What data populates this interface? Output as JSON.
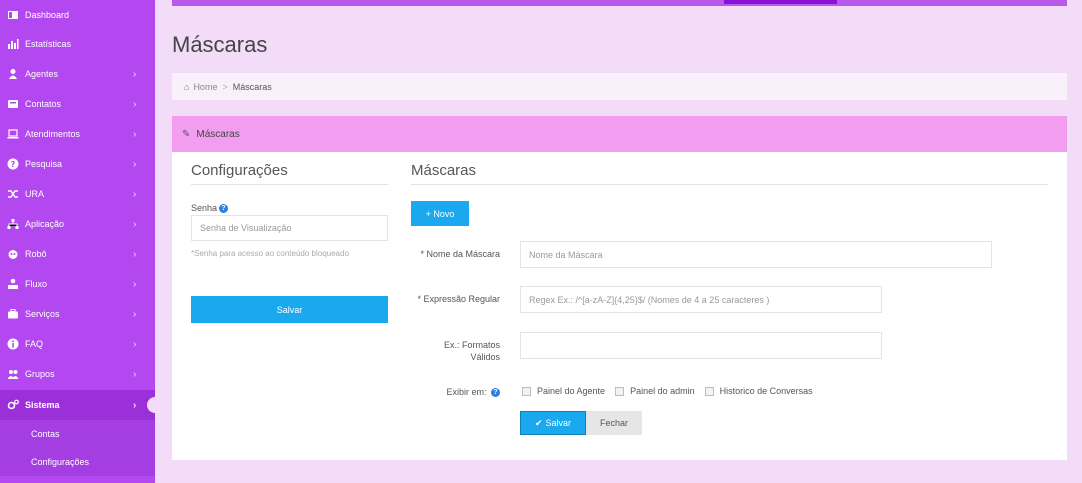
{
  "colors": {
    "sidebar": "#b348f0",
    "sidebar_active": "#9b2fd8",
    "page_bg": "#f3dcf8",
    "panel_header": "#f29ef0",
    "primary_button": "#1aa8ef",
    "topbar_accent": "#8a12d8"
  },
  "sidebar": {
    "items": [
      {
        "label": "Dashboard",
        "icon": "dashboard-icon",
        "has_children": false
      },
      {
        "label": "Estatísticas",
        "icon": "bar-chart-icon",
        "has_children": false
      },
      {
        "label": "Agentes",
        "icon": "person-icon",
        "has_children": true
      },
      {
        "label": "Contatos",
        "icon": "contact-card-icon",
        "has_children": true
      },
      {
        "label": "Atendimentos",
        "icon": "laptop-icon",
        "has_children": true
      },
      {
        "label": "Pesquisa",
        "icon": "question-circle-icon",
        "has_children": true
      },
      {
        "label": "URA",
        "icon": "shuffle-icon",
        "has_children": true
      },
      {
        "label": "Aplicação",
        "icon": "sitemap-icon",
        "has_children": true
      },
      {
        "label": "Robô",
        "icon": "robot-icon",
        "has_children": true
      },
      {
        "label": "Fluxo",
        "icon": "flow-icon",
        "has_children": true
      },
      {
        "label": "Serviços",
        "icon": "briefcase-icon",
        "has_children": true
      },
      {
        "label": "FAQ",
        "icon": "info-circle-icon",
        "has_children": true
      },
      {
        "label": "Grupos",
        "icon": "users-icon",
        "has_children": true
      },
      {
        "label": "Sistema",
        "icon": "cogs-icon",
        "has_children": true,
        "active": true
      }
    ],
    "subitems": [
      {
        "label": "Contas"
      },
      {
        "label": "Configurações"
      }
    ]
  },
  "page": {
    "title": "Máscaras"
  },
  "breadcrumb": {
    "home": "Home",
    "separator": ">",
    "current": "Máscaras"
  },
  "panel": {
    "title": "Máscaras"
  },
  "config": {
    "title": "Configurações",
    "password_label": "Senha",
    "password_placeholder": "Senha de Visualização",
    "hint": "*Senha para acesso ao conteúdo bloqueado",
    "save_label": "Salvar"
  },
  "masks": {
    "title": "Máscaras",
    "new_button": "+ Novo",
    "name_label": "Nome da Máscara",
    "name_placeholder": "Nome da Máscara",
    "regex_label": "Expressão Regular",
    "regex_placeholder": "Regex Ex.: /^[a-zA-Z]{4,25}$/ (Nomes de 4 a 25 caracteres )",
    "examples_label": "Ex.: Formatos Válidos",
    "examples_value": "",
    "display_label": "Exibir em:",
    "display_options": [
      "Painel do Agente",
      "Painel do admin",
      "Historico de Conversas"
    ],
    "save_label": "Salvar",
    "close_label": "Fechar"
  }
}
